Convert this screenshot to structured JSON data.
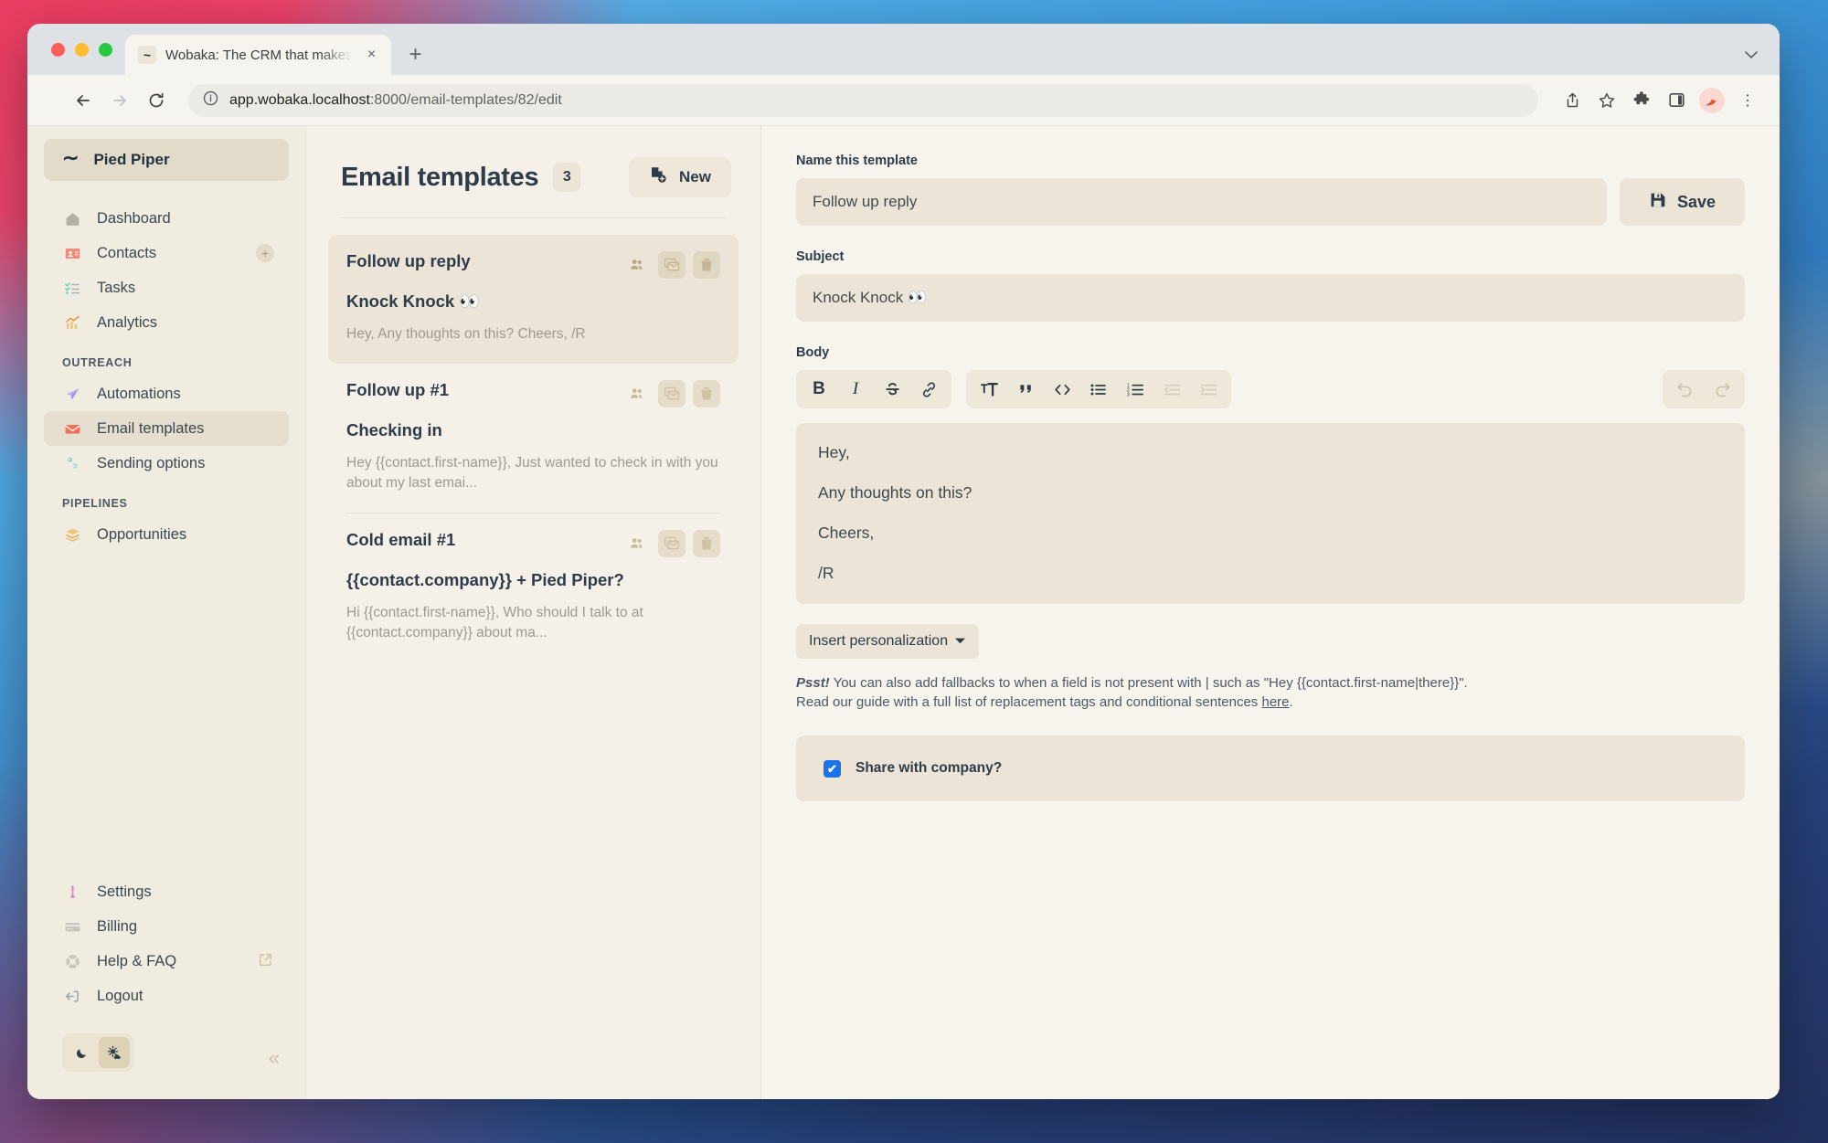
{
  "browser": {
    "tab": {
      "title": "Wobaka: The CRM that makes ",
      "favicon": "tilde-icon",
      "close": "×"
    },
    "new_tab": "+",
    "tabstrip_chevron": "⌄",
    "back": "←",
    "forward": "→",
    "reload": "↻",
    "site_info": "ⓘ",
    "url_prefix": "app.wobaka.localhost",
    "url_rest": ":8000/email-templates/82/edit",
    "icons": {
      "share": "share-icon",
      "bookmark": "☆",
      "extensions": "puzzle-icon",
      "side_panel": "side-panel-icon",
      "profile": "profile-avatar",
      "menu": "⋮"
    }
  },
  "sidebar": {
    "workspace": {
      "name": "Pied Piper",
      "logo": "∼"
    },
    "items": [
      {
        "label": "Dashboard",
        "icon": "home-icon",
        "glyph": "🏠",
        "active": false
      },
      {
        "label": "Contacts",
        "icon": "contacts-icon",
        "glyph": "🪪",
        "active": false,
        "plus": "+"
      },
      {
        "label": "Tasks",
        "icon": "tasks-icon",
        "glyph": "🗒",
        "active": false
      },
      {
        "label": "Analytics",
        "icon": "analytics-icon",
        "glyph": "📈",
        "active": false
      }
    ],
    "sections": [
      {
        "label": "OUTREACH",
        "items": [
          {
            "label": "Automations",
            "icon": "paper-plane-icon",
            "glyph": "🛸",
            "active": false
          },
          {
            "label": "Email templates",
            "icon": "envelope-icon",
            "glyph": "✉",
            "active": true
          },
          {
            "label": "Sending options",
            "icon": "gears-icon",
            "glyph": "⚙",
            "active": false
          }
        ]
      },
      {
        "label": "PIPELINES",
        "items": [
          {
            "label": "Opportunities",
            "icon": "layers-icon",
            "glyph": "📚",
            "active": false
          }
        ]
      }
    ],
    "bottom_items": [
      {
        "label": "Settings",
        "icon": "settings-icon",
        "glyph": "🧴"
      },
      {
        "label": "Billing",
        "icon": "credit-card-icon",
        "glyph": "💳"
      },
      {
        "label": "Help & FAQ",
        "icon": "life-ring-icon",
        "glyph": "🛡",
        "external": "↗"
      },
      {
        "label": "Logout",
        "icon": "logout-icon",
        "glyph": "↩"
      }
    ],
    "theme": {
      "dark": "☾",
      "light": "☀",
      "selected": "light"
    },
    "collapse": "«"
  },
  "list": {
    "title": "Email templates",
    "count": "3",
    "new_button": "New",
    "new_icon": "new-document-icon",
    "cards": [
      {
        "name": "Follow up reply",
        "subject": "Knock Knock 👀",
        "preview": "Hey, Any thoughts on this? Cheers, /R",
        "selected": true
      },
      {
        "name": "Follow up #1",
        "subject": "Checking in",
        "preview": "Hey {{contact.first-name}}, Just wanted to check in with you about my last emai...",
        "selected": false
      },
      {
        "name": "Cold email #1",
        "subject": "{{contact.company}} + Pied Piper?",
        "preview": "Hi {{contact.first-name}}, Who should I talk to at {{contact.company}} about ma...",
        "selected": false
      }
    ],
    "card_actions": [
      {
        "name": "share-users-icon",
        "boxed": false
      },
      {
        "name": "duplicate-email-icon",
        "boxed": true
      },
      {
        "name": "delete-icon",
        "boxed": true
      }
    ]
  },
  "editor": {
    "name_label": "Name this template",
    "name_value": "Follow up reply",
    "name_placeholder": "Name this template",
    "save_label": "Save",
    "save_icon": "floppy-disk-icon",
    "subject_label": "Subject",
    "subject_value": "Knock Knock 👀",
    "subject_placeholder": "Subject",
    "body_label": "Body",
    "toolbar_left": [
      {
        "name": "bold-icon",
        "glyph": "B",
        "disabled": false
      },
      {
        "name": "italic-icon",
        "glyph": "I",
        "disabled": false
      },
      {
        "name": "strikethrough-icon",
        "glyph": "S",
        "disabled": false
      },
      {
        "name": "link-icon",
        "glyph": "🔗",
        "disabled": false
      }
    ],
    "toolbar_mid": [
      {
        "name": "heading-icon",
        "glyph": "T",
        "disabled": false
      },
      {
        "name": "blockquote-icon",
        "glyph": "”",
        "disabled": false
      },
      {
        "name": "code-icon",
        "glyph": "<>",
        "disabled": false
      },
      {
        "name": "bullet-list-icon",
        "glyph": "•",
        "disabled": false
      },
      {
        "name": "numbered-list-icon",
        "glyph": "1.",
        "disabled": false
      },
      {
        "name": "outdent-icon",
        "glyph": "⇤",
        "disabled": true
      },
      {
        "name": "indent-icon",
        "glyph": "⇥",
        "disabled": true
      }
    ],
    "toolbar_right": [
      {
        "name": "undo-icon",
        "glyph": "↶",
        "disabled": true
      },
      {
        "name": "redo-icon",
        "glyph": "↷",
        "disabled": true
      }
    ],
    "body_lines": [
      "Hey,",
      "Any thoughts on this?",
      "Cheers,",
      "/R"
    ],
    "personalization_label": "Insert personalization",
    "personalization_caret": "▼",
    "hint_psst": "Psst!",
    "hint_line1": " You can also add fallbacks to when a field is not present with | such as \"Hey {{contact.first-name|there}}\".",
    "hint_line2_before": "Read our guide with a full list of replacement tags and conditional sentences ",
    "hint_link": "here",
    "hint_line2_after": ".",
    "share_label": "Share with company?",
    "share_checked": true,
    "check_glyph": "✔"
  },
  "colors": {
    "accent_blue": "#1a73e8",
    "panel": "#f7f4ed",
    "field": "#ece4d6",
    "sidebar": "#f0ece0",
    "text": "#2d3c4a"
  }
}
